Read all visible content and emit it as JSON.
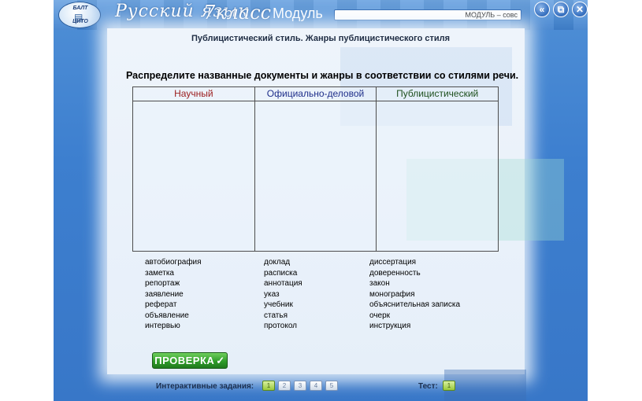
{
  "header": {
    "logo_top": "БАЛТ",
    "logo_bottom": "ЦИТО",
    "app_title": "Русский язык",
    "grade": "7класс",
    "module_label": "Модуль",
    "module_field_value": "МОДУЛЬ – совс",
    "buttons": [
      {
        "icon": "double-chevron-left-icon",
        "glyph": "«"
      },
      {
        "icon": "restore-window-icon",
        "glyph": "⧉"
      },
      {
        "icon": "close-icon",
        "glyph": "✕"
      }
    ]
  },
  "topic": "Публицистический стиль. Жанры публицистического стиля",
  "task": "Распределите названные документы и жанры в соответствии со стилями речи.",
  "table": {
    "columns": [
      {
        "label": "Научный",
        "color": "#9b1c1c"
      },
      {
        "label": "Официально-деловой",
        "color": "#1f2f8a"
      },
      {
        "label": "Публицистический",
        "color": "#1d4f1d"
      }
    ]
  },
  "words": {
    "col1": [
      "автобиография",
      "заметка",
      "репортаж",
      "заявление",
      "реферат",
      "объявление",
      "интервью"
    ],
    "col2": [
      "доклад",
      "расписка",
      "аннотация",
      "указ",
      "учебник",
      "статья",
      "протокол"
    ],
    "col3": [
      "диссертация",
      "доверенность",
      "закон",
      "монография",
      "объяснительная записка",
      "очерк",
      "инструкция"
    ]
  },
  "check_button": "ПРОВЕРКА",
  "footer": {
    "interactive_label": "Интерактивные задания:",
    "tasks": [
      "1",
      "2",
      "3",
      "4",
      "5"
    ],
    "active_task": "1",
    "test_label": "Тест:",
    "test_button": "1"
  }
}
